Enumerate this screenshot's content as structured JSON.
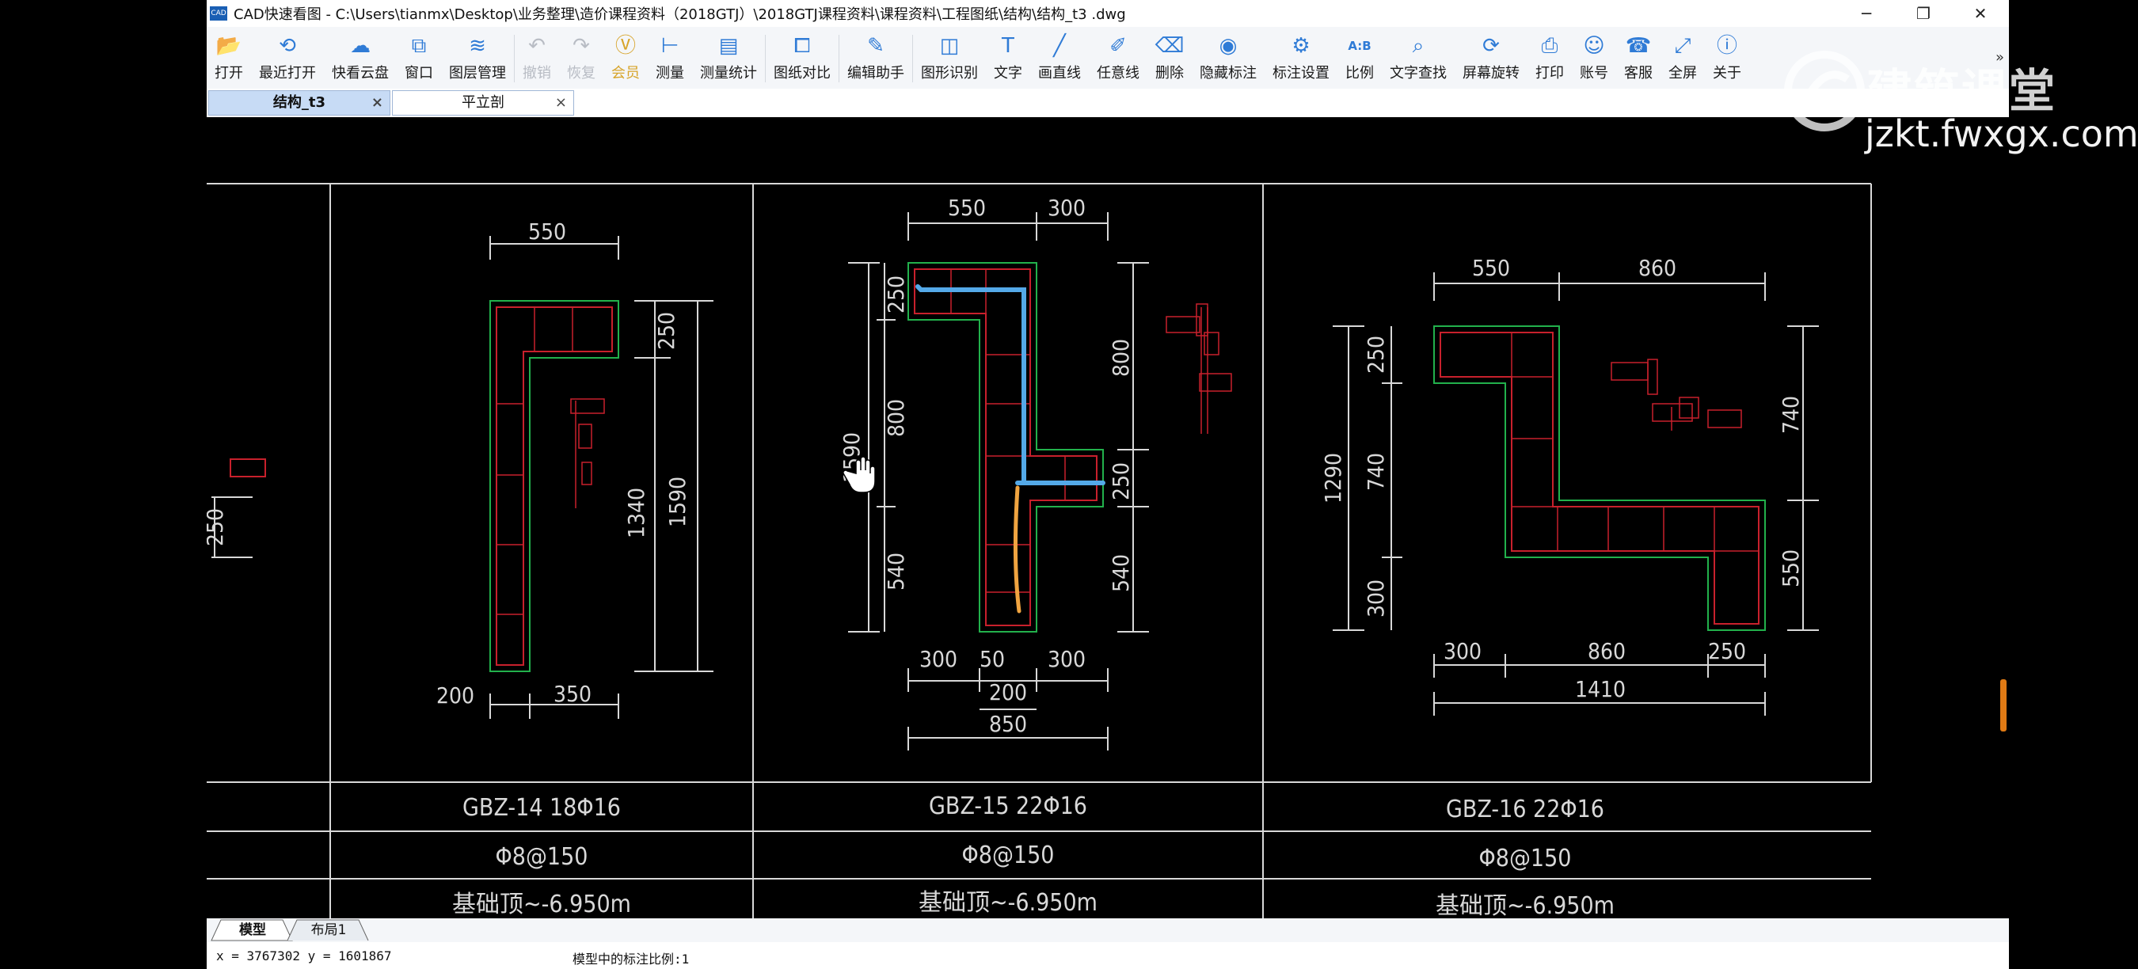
{
  "window": {
    "title": "CAD快速看图 - C:\\Users\\tianmx\\Desktop\\业务整理\\造价课程资料（2018GTJ）\\2018GTJ课程资料\\课程资料\\工程图纸\\结构\\结构_t3 .dwg",
    "logo_text": "CAD",
    "minimize": "─",
    "restore": "❐",
    "close": "✕"
  },
  "toolbar": [
    {
      "label": "打开",
      "icon": "folder-icon",
      "glyph": "📂",
      "state": "normal"
    },
    {
      "label": "最近打开",
      "icon": "history-icon",
      "glyph": "⟲",
      "state": "normal"
    },
    {
      "label": "快看云盘",
      "icon": "cloud-icon",
      "glyph": "☁",
      "state": "normal"
    },
    {
      "label": "窗口",
      "icon": "window-icon",
      "glyph": "⧉",
      "state": "normal"
    },
    {
      "label": "图层管理",
      "icon": "layers-icon",
      "glyph": "≋",
      "state": "normal"
    },
    {
      "label": "撤销",
      "icon": "undo-icon",
      "glyph": "↶",
      "state": "disabled"
    },
    {
      "label": "恢复",
      "icon": "redo-icon",
      "glyph": "↷",
      "state": "disabled"
    },
    {
      "label": "会员",
      "icon": "vip-icon",
      "glyph": "Ⓥ",
      "state": "vip"
    },
    {
      "label": "测量",
      "icon": "measure-icon",
      "glyph": "⊢",
      "state": "normal"
    },
    {
      "label": "测量统计",
      "icon": "measure-stats-icon",
      "glyph": "▤",
      "state": "normal"
    },
    {
      "label": "图纸对比",
      "icon": "compare-icon",
      "glyph": "⧠",
      "state": "normal"
    },
    {
      "label": "编辑助手",
      "icon": "edit-assistant-icon",
      "glyph": "✎",
      "state": "normal"
    },
    {
      "label": "图形识别",
      "icon": "shape-recognize-icon",
      "glyph": "◫",
      "state": "normal"
    },
    {
      "label": "文字",
      "icon": "text-icon",
      "glyph": "T",
      "state": "normal"
    },
    {
      "label": "画直线",
      "icon": "line-icon",
      "glyph": "╱",
      "state": "normal"
    },
    {
      "label": "任意线",
      "icon": "freehand-icon",
      "glyph": "✐",
      "state": "normal"
    },
    {
      "label": "删除",
      "icon": "eraser-icon",
      "glyph": "⌫",
      "state": "normal"
    },
    {
      "label": "隐藏标注",
      "icon": "hide-annotation-icon",
      "glyph": "◉",
      "state": "normal"
    },
    {
      "label": "标注设置",
      "icon": "annotation-settings-icon",
      "glyph": "⚙",
      "state": "normal"
    },
    {
      "label": "比例",
      "icon": "scale-icon",
      "glyph": "A:B",
      "state": "normal"
    },
    {
      "label": "文字查找",
      "icon": "text-search-icon",
      "glyph": "⌕",
      "state": "normal"
    },
    {
      "label": "屏幕旋转",
      "icon": "rotate-icon",
      "glyph": "⟳",
      "state": "normal"
    },
    {
      "label": "打印",
      "icon": "print-icon",
      "glyph": "⎙",
      "state": "normal"
    },
    {
      "label": "账号",
      "icon": "account-icon",
      "glyph": "☺",
      "state": "normal"
    },
    {
      "label": "客服",
      "icon": "support-icon",
      "glyph": "☎",
      "state": "normal"
    },
    {
      "label": "全屏",
      "icon": "fullscreen-icon",
      "glyph": "⤢",
      "state": "normal"
    },
    {
      "label": "关于",
      "icon": "about-icon",
      "glyph": "ⓘ",
      "state": "normal"
    }
  ],
  "toolbar_more": "»",
  "tabs": [
    {
      "label": "结构_t3",
      "active": true
    },
    {
      "label": "平立剖",
      "active": false
    }
  ],
  "tab_close": "×",
  "watermark": {
    "brand": "建筑课堂",
    "url": "jzkt.fwxgx.com"
  },
  "drawing": {
    "left_partial": {
      "dim": "250"
    },
    "panels": [
      {
        "name": "GBZ-14 18Φ16",
        "stirrup": "Φ8@150",
        "elevation": "基础顶~-6.950m",
        "dims": {
          "top": "550",
          "r1": "250",
          "r2": "1340",
          "r3": "1590",
          "b1": "200",
          "b2": "350"
        }
      },
      {
        "name": "GBZ-15 22Φ16",
        "stirrup": "Φ8@150",
        "elevation": "基础顶~-6.950m",
        "dims": {
          "t1": "550",
          "t2": "300",
          "l1": "1590",
          "l2": "250",
          "l3": "800",
          "l4": "540",
          "r1": "800",
          "r2": "250",
          "r3": "540",
          "b1": "300",
          "b2": "50",
          "b3": "300",
          "b4": "200",
          "b5": "850"
        }
      },
      {
        "name": "GBZ-16 22Φ16",
        "stirrup": "Φ8@150",
        "elevation": "基础顶~-6.950m",
        "dims": {
          "t1": "550",
          "t2": "860",
          "l1": "1290",
          "l2": "250",
          "l3": "740",
          "l4": "300",
          "r1": "740",
          "r2": "550",
          "b1": "300",
          "b2": "860",
          "b3": "250",
          "b4": "1410"
        }
      }
    ]
  },
  "colors": {
    "outline": "#22b14c",
    "rebar": "#c8202c",
    "dim": "#d8d8d8",
    "highlight_blue": "#54a9e8",
    "highlight_orange": "#f0a440"
  },
  "layout_tabs": [
    "模型",
    "布局1"
  ],
  "status": {
    "coords": "x = 3767302 y = 1601867",
    "scale": "模型中的标注比例:1"
  }
}
